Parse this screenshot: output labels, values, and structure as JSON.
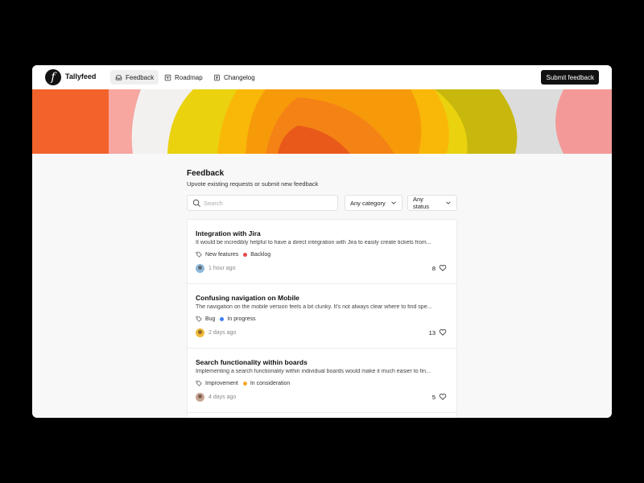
{
  "app": {
    "logo_letter": "f",
    "brand": "Tallyfeed"
  },
  "nav": {
    "tabs": [
      {
        "label": "Feedback",
        "icon": "inbox-icon",
        "active": true
      },
      {
        "label": "Roadmap",
        "icon": "board-icon",
        "active": false
      },
      {
        "label": "Changelog",
        "icon": "document-icon",
        "active": false
      }
    ],
    "submit_label": "Submit feedback"
  },
  "page": {
    "title": "Feedback",
    "subtitle": "Upvote existing requests or submit new feedback"
  },
  "filters": {
    "search_placeholder": "Search",
    "category": "Any category",
    "status": "Any status"
  },
  "colors": {
    "accent": "#111111",
    "status_backlog": "#e5484d",
    "status_in_progress": "#3e7bfa",
    "status_in_consideration": "#f5a524"
  },
  "feedback": [
    {
      "title": "Integration with Jira",
      "description": "It would be incredibly helpful to have a direct integration with Jira to easily create tickets from...",
      "category": "New features",
      "status": "Backlog",
      "status_color": "#e5484d",
      "time": "1 hour ago",
      "votes": "8",
      "avatar_color": "#8fb8d8"
    },
    {
      "title": "Confusing navigation on Mobile",
      "description": "The navigation on the mobile version feels a bit clunky. It's not always clear where to find spe...",
      "category": "Bug",
      "status": "In progress",
      "status_color": "#3e7bfa",
      "time": "2 days ago",
      "votes": "13",
      "avatar_color": "#f0b93a"
    },
    {
      "title": "Search functionality within boards",
      "description": "Implementing a search functionality within individual boards would make it much easier to fin...",
      "category": "Improvement",
      "status": "In consideration",
      "status_color": "#f5a524",
      "time": "4 days ago",
      "votes": "5",
      "avatar_color": "#c9a593"
    }
  ]
}
